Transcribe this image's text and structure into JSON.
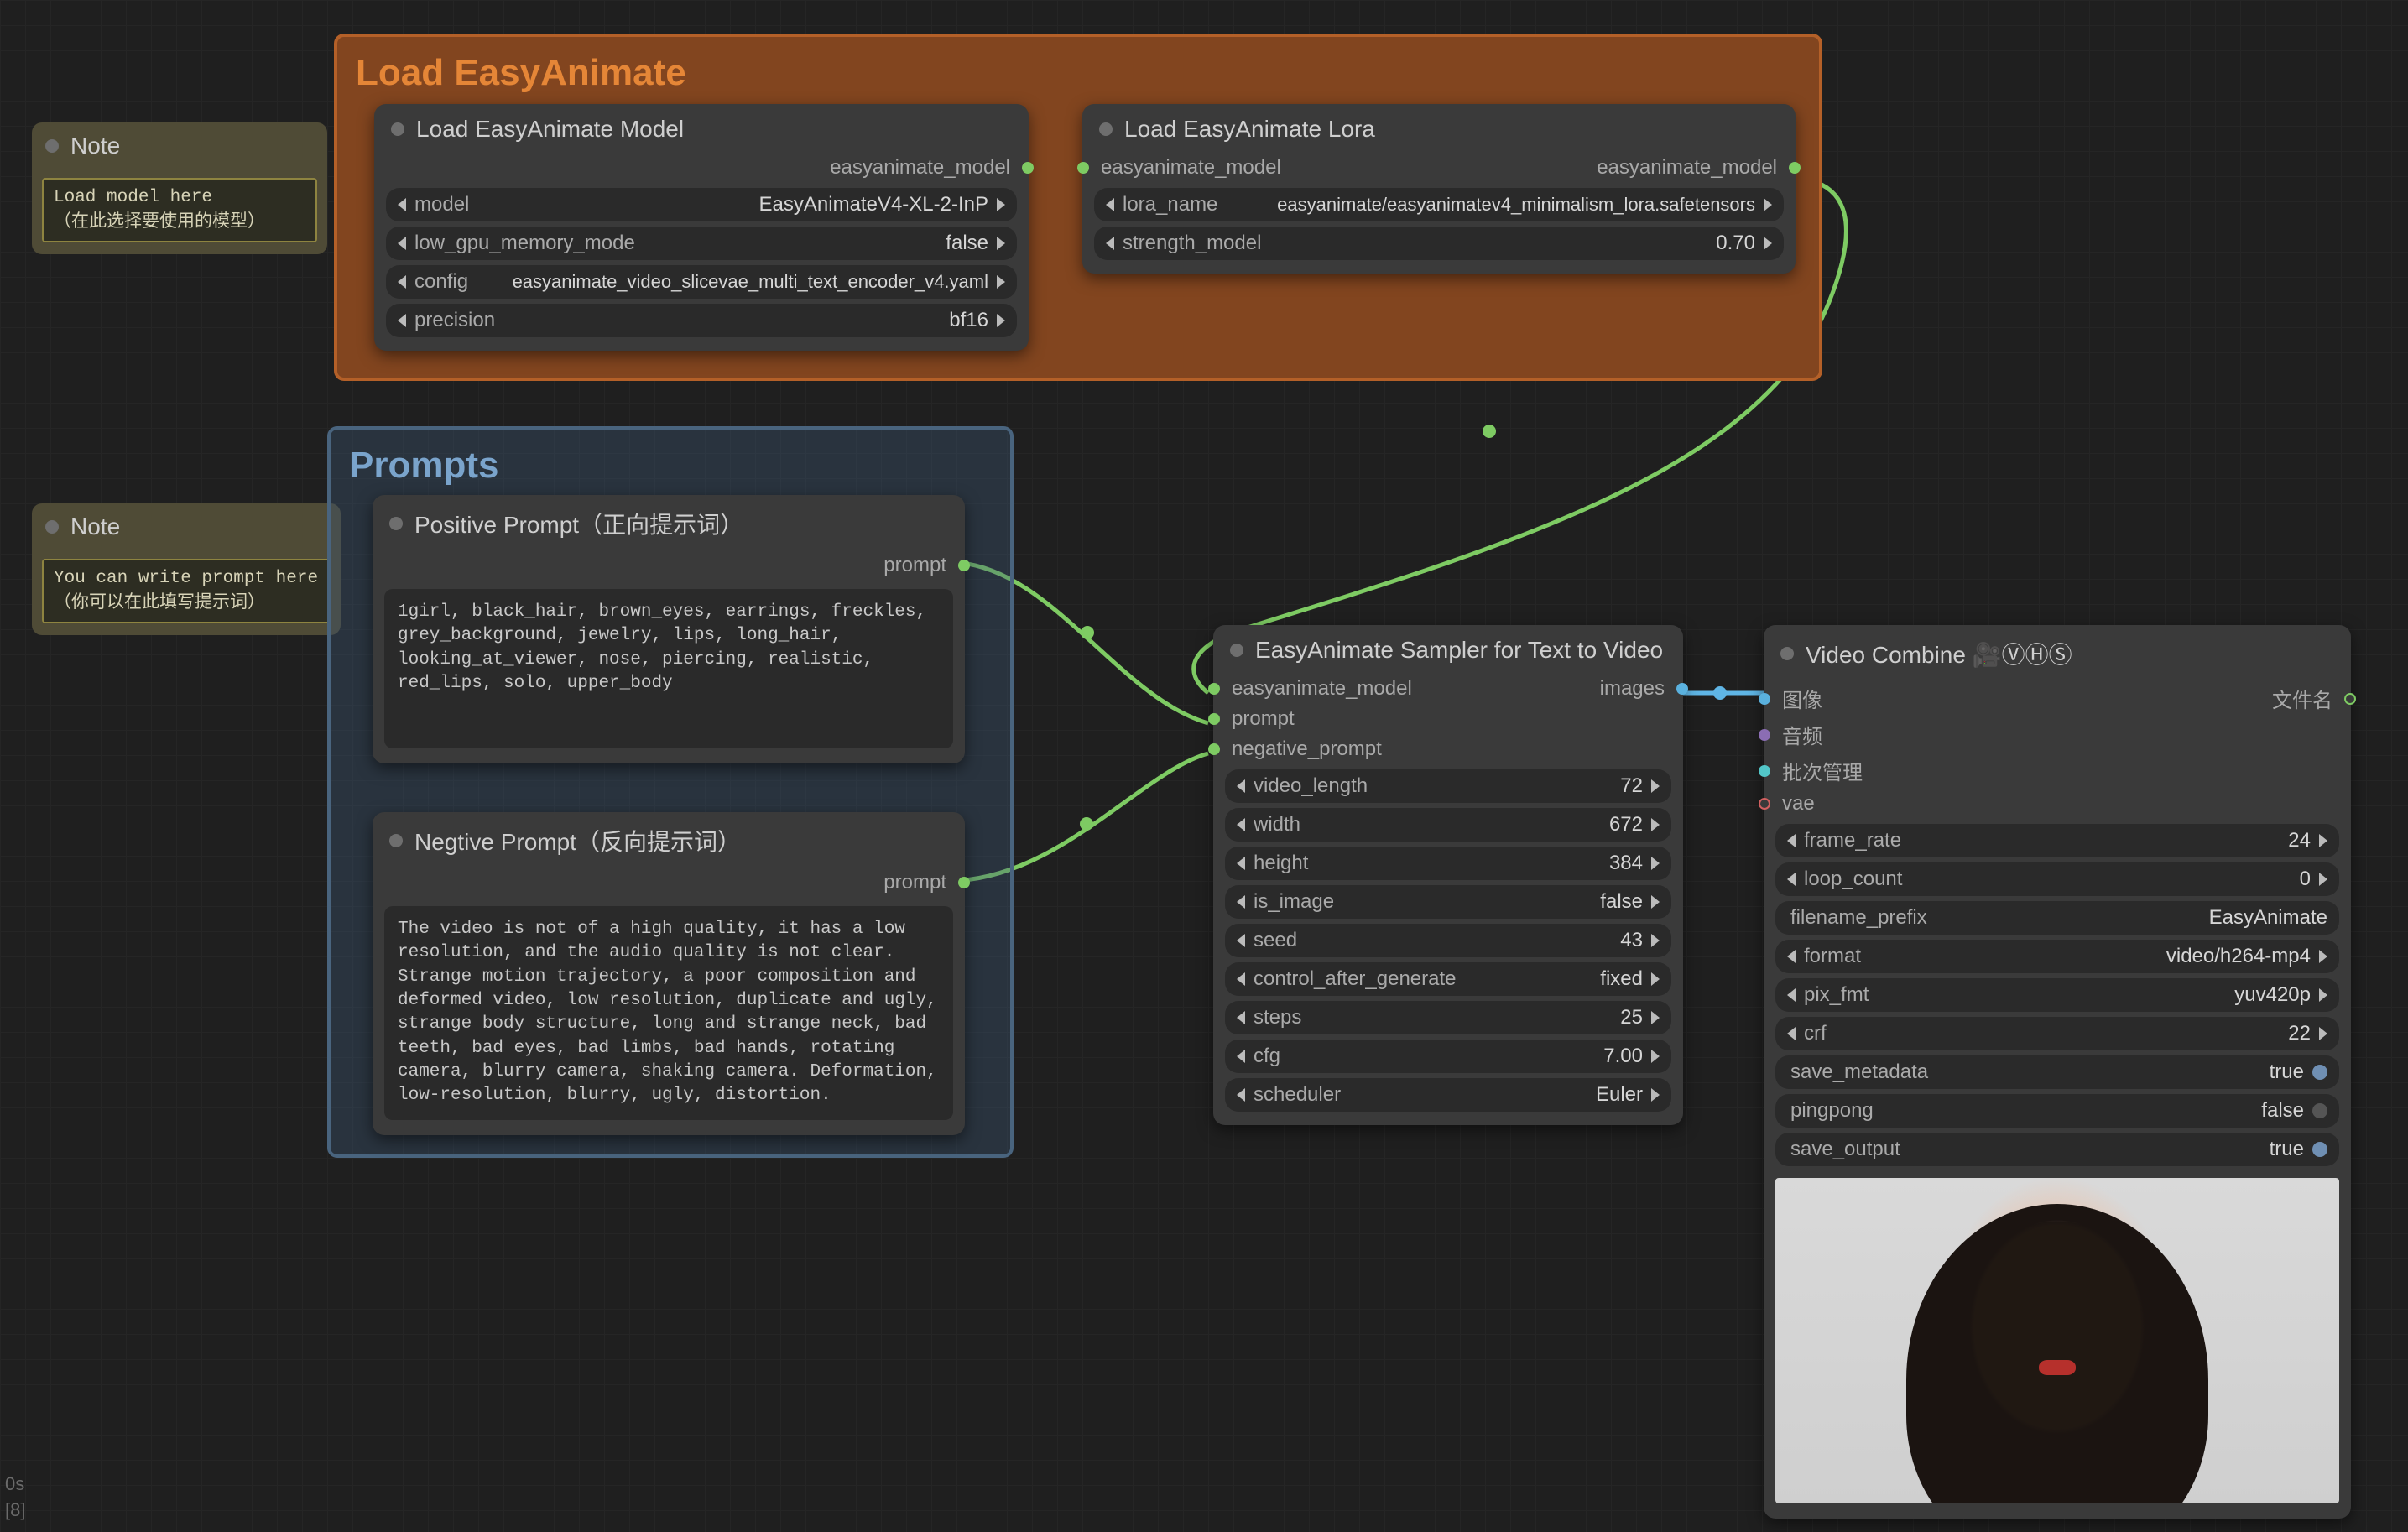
{
  "corner": {
    "line1": "0s",
    "line2": "[8]"
  },
  "notes": {
    "note1": {
      "title": "Note",
      "body": "Load model here\n（在此选择要使用的模型）"
    },
    "note2": {
      "title": "Note",
      "body": "You can write prompt here\n（你可以在此填写提示词）"
    }
  },
  "groups": {
    "load": {
      "title": "Load EasyAnimate"
    },
    "prompts": {
      "title": "Prompts"
    }
  },
  "nodes": {
    "load_model": {
      "title": "Load EasyAnimate Model",
      "output": "easyanimate_model",
      "widgets": {
        "model": {
          "label": "model",
          "value": "EasyAnimateV4-XL-2-InP"
        },
        "lowgpu": {
          "label": "low_gpu_memory_mode",
          "value": "false"
        },
        "config": {
          "label": "config",
          "value": "easyanimate_video_slicevae_multi_text_encoder_v4.yaml"
        },
        "prec": {
          "label": "precision",
          "value": "bf16"
        }
      }
    },
    "load_lora": {
      "title": "Load EasyAnimate Lora",
      "input": "easyanimate_model",
      "output": "easyanimate_model",
      "widgets": {
        "lora": {
          "label": "lora_name",
          "value": "easyanimate/easyanimatev4_minimalism_lora.safetensors"
        },
        "strength": {
          "label": "strength_model",
          "value": "0.70"
        }
      }
    },
    "pos_prompt": {
      "title": "Positive Prompt（正向提示词）",
      "output": "prompt",
      "text": "1girl, black_hair, brown_eyes, earrings, freckles, grey_background, jewelry, lips, long_hair, looking_at_viewer, nose, piercing, realistic, red_lips, solo, upper_body"
    },
    "neg_prompt": {
      "title": "Negtive Prompt（反向提示词）",
      "output": "prompt",
      "text": "The video is not of a high quality, it has a low resolution, and the audio quality is not clear. Strange motion trajectory, a poor composition and deformed video, low resolution, duplicate and ugly, strange body structure, long and strange neck, bad teeth, bad eyes, bad limbs, bad hands, rotating camera, blurry camera, shaking camera. Deformation, low-resolution, blurry, ugly, distortion."
    },
    "sampler": {
      "title": "EasyAnimate Sampler for Text to Video",
      "inputs": {
        "model": "easyanimate_model",
        "prompt": "prompt",
        "neg": "negative_prompt"
      },
      "output": "images",
      "widgets": {
        "video_length": {
          "label": "video_length",
          "value": "72"
        },
        "width": {
          "label": "width",
          "value": "672"
        },
        "height": {
          "label": "height",
          "value": "384"
        },
        "is_image": {
          "label": "is_image",
          "value": "false"
        },
        "seed": {
          "label": "seed",
          "value": "43"
        },
        "control_after_generate": {
          "label": "control_after_generate",
          "value": "fixed"
        },
        "steps": {
          "label": "steps",
          "value": "25"
        },
        "cfg": {
          "label": "cfg",
          "value": "7.00"
        },
        "scheduler": {
          "label": "scheduler",
          "value": "Euler"
        }
      }
    },
    "video_combine": {
      "title": "Video Combine 🎥ⓋⒽⓈ",
      "inputs": {
        "images": "图像",
        "audio": "音频",
        "batch": "批次管理",
        "vae": "vae"
      },
      "output": "文件名",
      "widgets": {
        "frame_rate": {
          "label": "frame_rate",
          "value": "24"
        },
        "loop_count": {
          "label": "loop_count",
          "value": "0"
        },
        "filename_prefix": {
          "label": "filename_prefix",
          "value": "EasyAnimate"
        },
        "format": {
          "label": "format",
          "value": "video/h264-mp4"
        },
        "pix_fmt": {
          "label": "pix_fmt",
          "value": "yuv420p"
        },
        "crf": {
          "label": "crf",
          "value": "22"
        },
        "save_metadata": {
          "label": "save_metadata",
          "value": "true"
        },
        "pingpong": {
          "label": "pingpong",
          "value": "false"
        },
        "save_output": {
          "label": "save_output",
          "value": "true"
        }
      }
    }
  }
}
